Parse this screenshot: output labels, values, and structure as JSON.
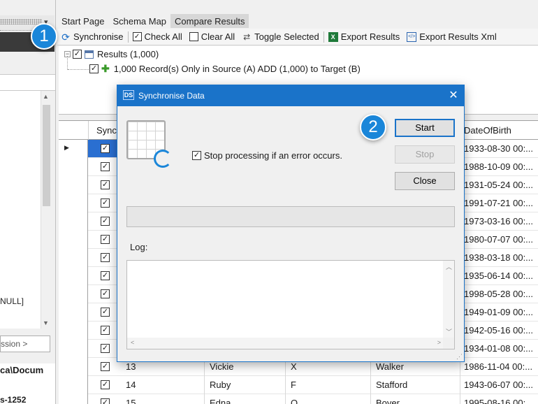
{
  "left_panel": {
    "null_fragment": "NULL]",
    "session_fragment": "ssion >",
    "path_fragment": "ca\\Docum",
    "codepage_fragment": "s-1252"
  },
  "tabs": [
    {
      "label": "Start Page"
    },
    {
      "label": "Schema Map"
    },
    {
      "label": "Compare Results"
    }
  ],
  "toolbar": {
    "synchronise": "Synchronise",
    "check_all": "Check All",
    "clear_all": "Clear All",
    "toggle_selected": "Toggle Selected",
    "export_results": "Export Results",
    "export_results_xml": "Export Results Xml",
    "check_glyph": "✓",
    "excel_glyph": "X",
    "xml_glyph": "</>"
  },
  "tree": {
    "root_label": "Results (1,000)",
    "child_label": "1,000 Record(s) Only in Source (A) ADD (1,000) to Target (B)",
    "expander_glyph": "−",
    "plus_glyph": "✚",
    "check_glyph": "✓"
  },
  "grid": {
    "headers": {
      "sync": "Sync",
      "dob": "DateOfBirth"
    },
    "dob_values": [
      "1933-08-30 00:...",
      "1988-10-09 00:...",
      "1931-05-24 00:...",
      "1991-07-21 00:...",
      "1973-03-16 00:...",
      "1980-07-07 00:...",
      "1938-03-18 00:...",
      "1935-06-14 00:...",
      "1998-05-28 00:...",
      "1949-01-09 00:...",
      "1942-05-16 00:...",
      "1934-01-08 00:..."
    ],
    "rows": [
      {
        "id": "13",
        "first": "Vickie",
        "mi": "X",
        "last": "Walker",
        "dob": "1986-11-04 00:..."
      },
      {
        "id": "14",
        "first": "Ruby",
        "mi": "F",
        "last": "Stafford",
        "dob": "1943-06-07 00:..."
      },
      {
        "id": "15",
        "first": "Edna",
        "mi": "Q",
        "last": "Boyer",
        "dob": "1995-08-16 00:..."
      }
    ]
  },
  "dialog": {
    "title": "Synchronise Data",
    "icon_text": "DS",
    "close_glyph": "✕",
    "stop_on_error_label": "Stop processing if an error occurs.",
    "stop_on_error_checked": true,
    "start_button": "Start",
    "stop_button": "Stop",
    "close_button": "Close",
    "log_label": "Log:",
    "progress_fraction": 0
  },
  "badges": {
    "step1": "1",
    "step2": "2"
  },
  "colors": {
    "accent": "#1a73c9",
    "badge": "#1a86d9",
    "selection": "#2a6fd1"
  }
}
